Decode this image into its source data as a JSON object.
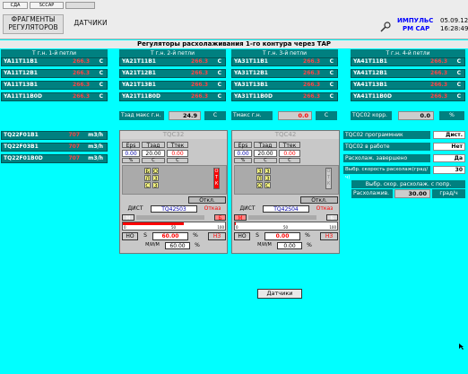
{
  "topbar": {
    "btn1": "СДА",
    "btn2": "SCCAP",
    "btn3": "",
    "nav1": "ФРАГМЕНТЫ РЕГУЛЯТОРОВ",
    "nav2": "ДАТЧИКИ",
    "impuls": "ИМПУЛЬС",
    "rmcap": "РМ САР",
    "date": "05.09.12",
    "time": "16:28:49"
  },
  "title": "Регуляторы расхолаживания 1-го контура через ТАР",
  "loops": [
    {
      "header": "Т г.н. 1-й петли",
      "rows": [
        {
          "n": "YA11T11B1",
          "v": "266.3",
          "u": "С"
        },
        {
          "n": "YA11T12B1",
          "v": "266.3",
          "u": "С"
        },
        {
          "n": "YA11T13B1",
          "v": "266.3",
          "u": "С"
        },
        {
          "n": "YA11T11B0D",
          "v": "266.3",
          "u": "С"
        }
      ]
    },
    {
      "header": "Т г.н. 2-й петли",
      "rows": [
        {
          "n": "YA21T11B1",
          "v": "266.3",
          "u": "С"
        },
        {
          "n": "YA21T12B1",
          "v": "266.3",
          "u": "С"
        },
        {
          "n": "YA21T13B1",
          "v": "266.3",
          "u": "С"
        },
        {
          "n": "YA21T11B0D",
          "v": "266.3",
          "u": "С"
        }
      ]
    },
    {
      "header": "Т г.н. 3-й петли",
      "rows": [
        {
          "n": "YA31T11B1",
          "v": "266.3",
          "u": "С"
        },
        {
          "n": "YA31T12B1",
          "v": "266.3",
          "u": "С"
        },
        {
          "n": "YA31T13B1",
          "v": "266.3",
          "u": "С"
        },
        {
          "n": "YA31T11B0D",
          "v": "266.3",
          "u": "С"
        }
      ]
    },
    {
      "header": "Т г.н. 4-й петли",
      "rows": [
        {
          "n": "YA41T11B1",
          "v": "266.3",
          "u": "С"
        },
        {
          "n": "YA41T12B1",
          "v": "266.3",
          "u": "С"
        },
        {
          "n": "YA41T13B1",
          "v": "266.3",
          "u": "С"
        },
        {
          "n": "YA41T11B0D",
          "v": "266.3",
          "u": "С"
        }
      ]
    }
  ],
  "tzad": {
    "label": "Тзад макс г.н.",
    "value": "24.9",
    "unit": "С"
  },
  "tmax": {
    "label": "Тмакс г.н.",
    "value": "0.0",
    "unit": "С"
  },
  "tqc02": {
    "label": "TQC02 корр.",
    "value": "0.0",
    "unit": "%"
  },
  "flows": [
    {
      "n": "TQ22F01B1",
      "v": "707",
      "u": "m3/h"
    },
    {
      "n": "TQ22F03B1",
      "v": "707",
      "u": "m3/h"
    },
    {
      "n": "TQ22F01B0D",
      "v": "707",
      "u": "m3/h"
    }
  ],
  "reg1": {
    "title": "TQC32",
    "eps": "Eps",
    "tzad": "Tзад",
    "ttek": "Ттек",
    "eps_v": "0.00",
    "tzad_v": "20.00",
    "ttek_v": "0.00",
    "u1": "%",
    "u2": "С",
    "u3": "С",
    "col1": [
      "Б",
      "Л",
      "С"
    ],
    "col2": [
      "О",
      "З",
      "З"
    ],
    "redcol": "О Т К",
    "otkl": "Откл.",
    "dist": "ДИСТ",
    "name": "TQ42S03",
    "otkaz": "Отказ",
    "m": "М",
    "b": "Б",
    "scale0": "0",
    "scale50": "50",
    "scale100": "100",
    "ho": "НО",
    "s": "S",
    "pos": "60.00",
    "pct": "%",
    "hz": "НЗ",
    "mim": "М/И/М",
    "mim_v": "60.00",
    "mim_u": "%"
  },
  "reg2": {
    "title": "TQC42",
    "eps": "Eps",
    "tzad": "Tзад",
    "ttek": "Ттек",
    "eps_v": "0.00",
    "tzad_v": "20.00",
    "ttek_v": "0.00",
    "u1": "%",
    "u2": "С",
    "u3": "С",
    "col1": [
      "З",
      "Л",
      "О"
    ],
    "col2": [
      "З",
      "З",
      "С"
    ],
    "redcol": "О Т К",
    "otkl": "Откл.",
    "dist": "ДИСТ",
    "name": "TQ42S04",
    "otkaz": "Отказ",
    "m": "М",
    "b": "Б",
    "scale0": "0",
    "scale50": "50",
    "scale100": "100",
    "ho": "НО",
    "s": "S",
    "pos": "0.00",
    "pct": "%",
    "hz": "НЗ",
    "mim": "М/И/М",
    "mim_v": "0.00",
    "mim_u": "%"
  },
  "status": [
    {
      "l": "TQC02 программник",
      "v": "Дист."
    },
    {
      "l": "TQC02 в работе",
      "v": "Нет"
    },
    {
      "l": "Расхолаж. завершено",
      "v": "Да"
    },
    {
      "l": "Выбр. скорость расхолаж(град/ч)",
      "v": "30"
    }
  ],
  "speed": {
    "title": "Выбр. скор. расхолаж. с попр.",
    "label": "Расхолажив.",
    "value": "30.00",
    "unit": "град/ч"
  },
  "sensorsBtn": "Датчики",
  "colors": {
    "accent": "#008080",
    "background": "#00ffff",
    "alarm": "#ff0000"
  }
}
